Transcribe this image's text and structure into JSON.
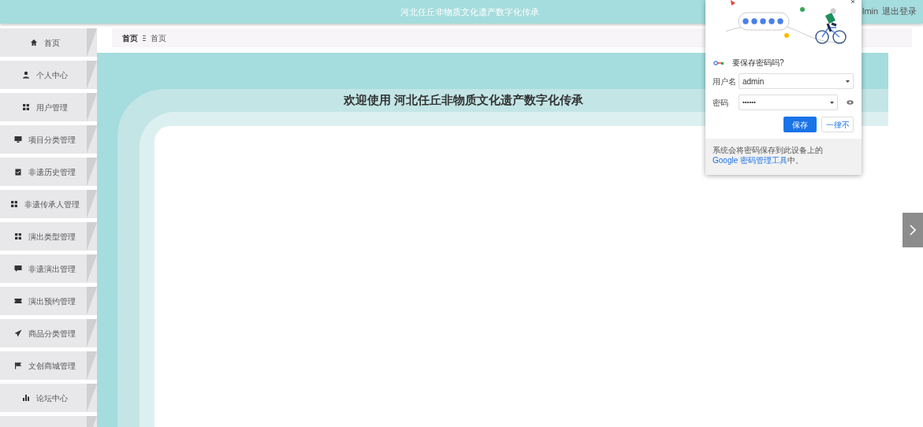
{
  "header": {
    "title": "河北任丘非物质文化遗产数字化传承",
    "user": "lmin",
    "logout": "退出登录"
  },
  "sidebar": {
    "items": [
      {
        "label": "首页",
        "kind": "home"
      },
      {
        "label": "个人中心",
        "kind": "user"
      },
      {
        "label": "用户管理",
        "kind": "grid"
      },
      {
        "label": "项目分类管理",
        "kind": "monitor"
      },
      {
        "label": "非遗历史管理",
        "kind": "clipboard"
      },
      {
        "label": "非遗传承人管理",
        "kind": "grid"
      },
      {
        "label": "演出类型管理",
        "kind": "grid"
      },
      {
        "label": "非遗演出管理",
        "kind": "chat"
      },
      {
        "label": "演出预约管理",
        "kind": "ticket"
      },
      {
        "label": "商品分类管理",
        "kind": "send"
      },
      {
        "label": "文创商城管理",
        "kind": "flag"
      },
      {
        "label": "论坛中心",
        "kind": "chart"
      }
    ]
  },
  "breadcrumb": [
    "首页",
    "首页"
  ],
  "welcome": "欢迎使用 河北任丘非物质文化遗产数字化传承",
  "password_popup": {
    "question": "要保存密码吗?",
    "username_label": "用户名",
    "username": "admin",
    "password_label": "密码",
    "password": "••••••",
    "save": "保存",
    "never": "一律不",
    "footer": "系统会将密码保存到此设备上的 ",
    "footer_link": "Google 密码管理工具",
    "footer_end": "中。"
  }
}
